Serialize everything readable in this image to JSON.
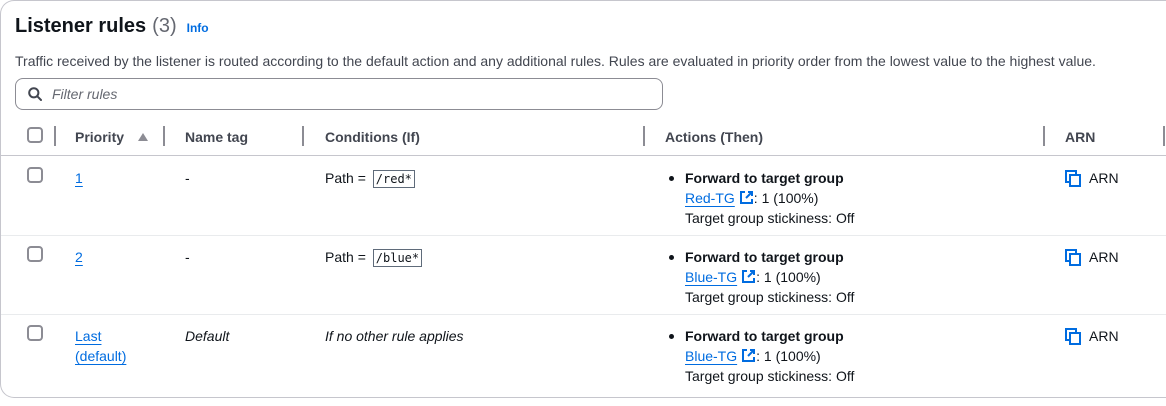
{
  "header": {
    "title": "Listener rules",
    "count": "(3)",
    "info_label": "Info",
    "description": "Traffic received by the listener is routed according to the default action and any additional rules. Rules are evaluated in priority order from the lowest value to the highest value."
  },
  "search": {
    "placeholder": "Filter rules",
    "value": ""
  },
  "columns": {
    "priority": "Priority",
    "name_tag": "Name tag",
    "conditions": "Conditions (If)",
    "actions": "Actions (Then)",
    "arn": "ARN"
  },
  "rows": [
    {
      "priority": "1",
      "name_tag": "-",
      "condition_prefix": "Path =",
      "condition_value": "/red*",
      "action_title": "Forward to target group",
      "target_group": "Red-TG",
      "weight": ": 1 (100%)",
      "stickiness": "Target group stickiness: Off",
      "arn_label": "ARN"
    },
    {
      "priority": "2",
      "name_tag": "-",
      "condition_prefix": "Path =",
      "condition_value": "/blue*",
      "action_title": "Forward to target group",
      "target_group": "Blue-TG",
      "weight": ": 1 (100%)",
      "stickiness": "Target group stickiness: Off",
      "arn_label": "ARN"
    },
    {
      "priority_line1": "Last",
      "priority_line2": "(default)",
      "name_tag": "Default",
      "condition_text": "If no other rule applies",
      "action_title": "Forward to target group",
      "target_group": "Blue-TG",
      "weight": ": 1 (100%)",
      "stickiness": "Target group stickiness: Off",
      "arn_label": "ARN"
    }
  ],
  "colors": {
    "link": "#006ce0",
    "text": "#0f141a",
    "muted": "#656871",
    "border": "#c6c6cd"
  }
}
